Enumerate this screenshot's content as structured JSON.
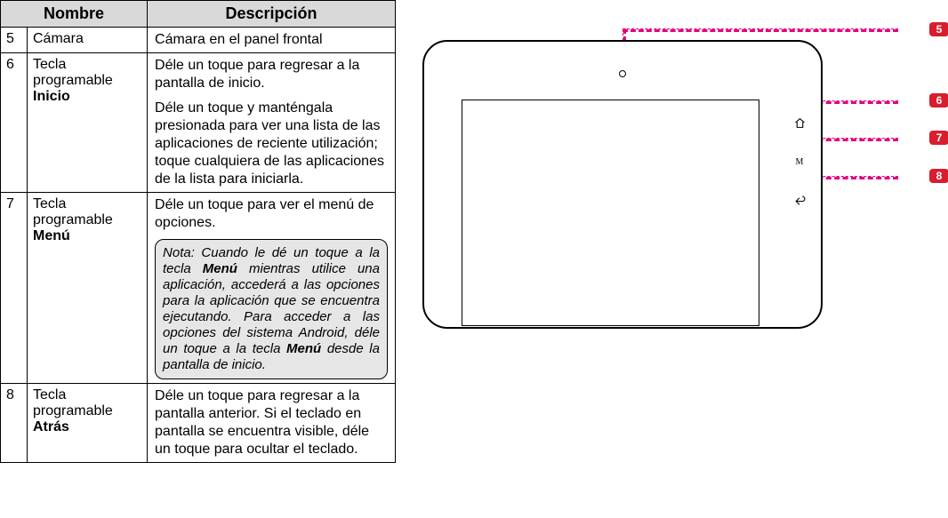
{
  "table": {
    "headers": {
      "name": "Nombre",
      "desc": "Descripción"
    },
    "rows": [
      {
        "num": "5",
        "name_plain": "Cámara",
        "desc_paras": [
          "Cámara en el panel frontal"
        ]
      },
      {
        "num": "6",
        "name_plain": "Tecla programable ",
        "name_bold": "Inicio",
        "desc_paras": [
          "Déle un toque para regresar a la pantalla de inicio.",
          "Déle un toque y manténgala presionada para ver una lista de las aplicaciones de reciente utilización; toque cualquiera de las aplicaciones de la lista para iniciarla."
        ]
      },
      {
        "num": "7",
        "name_plain": "Tecla programable ",
        "name_bold": "Menú",
        "desc_paras": [
          "Déle un toque para ver el menú de opciones."
        ],
        "note": {
          "pre": "Nota: Cuando le dé un toque a la tecla ",
          "b1": "Menú",
          "mid": " mientras utilice una aplicación, accederá a las opciones para la aplicación que se encuentra ejecutando. Para acceder a las opciones del sistema Android, déle un toque a la tecla ",
          "b2": "Menú",
          "post": " desde la pantalla de inicio."
        }
      },
      {
        "num": "8",
        "name_plain": "Tecla programable ",
        "name_bold": "Atrás",
        "desc_paras": [
          "Déle un toque para regresar a la pantalla anterior. Si el teclado en pantalla se encuentra visible, déle un toque para ocultar el teclado."
        ]
      }
    ]
  },
  "diagram": {
    "callouts": {
      "c5": "5",
      "c6": "6",
      "c7": "7",
      "c8": "8"
    },
    "menu_glyph": "M"
  }
}
